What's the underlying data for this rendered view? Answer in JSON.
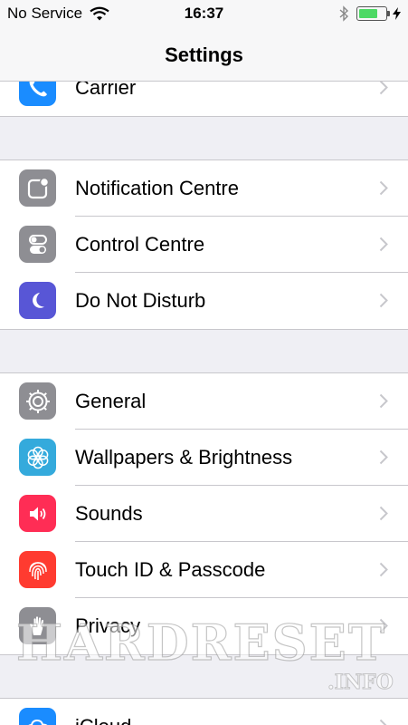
{
  "status_bar": {
    "carrier": "No Service",
    "time": "16:37",
    "battery_level": 0.7
  },
  "nav": {
    "title": "Settings"
  },
  "groups": [
    {
      "items": [
        {
          "label": "Carrier",
          "icon": "phone-icon",
          "color": "#1a8cff"
        }
      ]
    },
    {
      "items": [
        {
          "label": "Notification Centre",
          "icon": "notification-centre-icon",
          "color": "#8e8e93"
        },
        {
          "label": "Control Centre",
          "icon": "control-centre-icon",
          "color": "#8e8e93"
        },
        {
          "label": "Do Not Disturb",
          "icon": "moon-icon",
          "color": "#5856d6"
        }
      ]
    },
    {
      "items": [
        {
          "label": "General",
          "icon": "gear-icon",
          "color": "#8e8e93"
        },
        {
          "label": "Wallpapers & Brightness",
          "icon": "flower-icon",
          "color": "#34aadc"
        },
        {
          "label": "Sounds",
          "icon": "speaker-icon",
          "color": "#ff2d55"
        },
        {
          "label": "Touch ID & Passcode",
          "icon": "fingerprint-icon",
          "color": "#ff3b30"
        },
        {
          "label": "Privacy",
          "icon": "hand-icon",
          "color": "#8e8e93"
        }
      ]
    },
    {
      "items": [
        {
          "label": "iCloud",
          "icon": "cloud-icon",
          "color": "#1a8cff"
        }
      ]
    }
  ],
  "watermark": {
    "main": "HARDRESET",
    "sub": ".INFO"
  }
}
